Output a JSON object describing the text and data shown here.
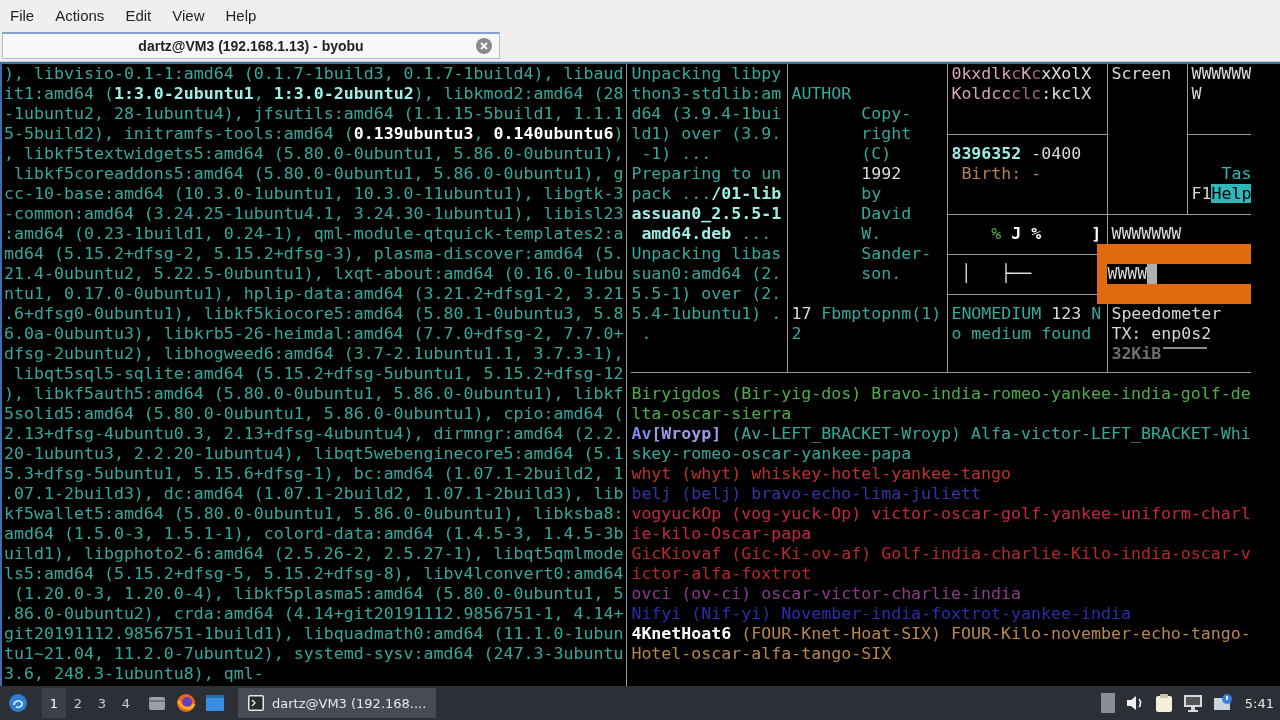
{
  "menu": [
    "File",
    "Actions",
    "Edit",
    "View",
    "Help"
  ],
  "tab": {
    "title": "dartz@VM3 (192.168.1.13) - byobu"
  },
  "terminal": {
    "main_pane": {
      "lines": [
        [
          {
            "text": "), libvisio-0.1-1:amd64 (0.1.7-1build3, 0.1.7-1build4), libaud"
          }
        ],
        [
          {
            "text": "it1:amd64 ("
          },
          {
            "text": "1:3.0-2ubuntu1",
            "bold": true,
            "color": "#9eeee6"
          },
          {
            "text": ", "
          },
          {
            "text": "1:3.0-2ubuntu2",
            "bold": true,
            "color": "#9eeee6"
          },
          {
            "text": "), libkmod2:amd64 (28"
          }
        ],
        [
          {
            "text": "-1ubuntu2, 28-1ubuntu4), jfsutils:amd64 (1.1.15-5build1, 1.1.1"
          }
        ],
        [
          {
            "text": "5-5build2), initramfs-tools:amd64 ("
          },
          {
            "text": "0.139ubuntu3",
            "bold": true,
            "color": "#ffffff"
          },
          {
            "text": ", "
          },
          {
            "text": "0.140ubuntu6",
            "bold": true,
            "color": "#ffffff"
          },
          {
            "text": ")"
          }
        ],
        [
          {
            "text": ", libkf5textwidgets5:amd64 (5.80.0-0ubuntu1, 5.86.0-0ubuntu1),"
          }
        ],
        [
          {
            "text": " libkf5coreaddons5:amd64 (5.80.0-0ubuntu1, 5.86.0-0ubuntu1), g"
          }
        ],
        [
          {
            "text": "cc-10-base:amd64 (10.3.0-1ubuntu1, 10.3.0-11ubuntu1), libgtk-3"
          }
        ],
        [
          {
            "text": "-common:amd64 (3.24.25-1ubuntu4.1, 3.24.30-1ubuntu1), libisl23"
          }
        ],
        [
          {
            "text": ":amd64 (0.23-1build1, 0.24-1), qml-module-qtquick-templates2:a"
          }
        ],
        [
          {
            "text": "md64 (5.15.2+dfsg-2, 5.15.2+dfsg-3), plasma-discover:amd64 (5."
          }
        ],
        [
          {
            "text": "21.4-0ubuntu2, 5.22.5-0ubuntu1), lxqt-about:amd64 (0.16.0-1ubu"
          }
        ],
        [
          {
            "text": "ntu1, 0.17.0-0ubuntu1), hplip-data:amd64 (3.21.2+dfsg1-2, 3.21"
          }
        ],
        [
          {
            "text": ".6+dfsg0-0ubuntu1), libkf5kiocore5:amd64 (5.80.1-0ubuntu3, 5.8"
          }
        ],
        [
          {
            "text": "6.0a-0ubuntu3), libkrb5-26-heimdal:amd64 (7.7.0+dfsg-2, 7.7.0+"
          }
        ],
        [
          {
            "text": "dfsg-2ubuntu2), libhogweed6:amd64 (3.7-2.1ubuntu1.1, 3.7.3-1),"
          }
        ],
        [
          {
            "text": " libqt5sql5-sqlite:amd64 (5.15.2+dfsg-5ubuntu1, 5.15.2+dfsg-12"
          }
        ],
        [
          {
            "text": "), libkf5auth5:amd64 (5.80.0-0ubuntu1, 5.86.0-0ubuntu1), libkf"
          }
        ],
        [
          {
            "text": "5solid5:amd64 (5.80.0-0ubuntu1, 5.86.0-0ubuntu1), cpio:amd64 ("
          }
        ],
        [
          {
            "text": "2.13+dfsg-4ubuntu0.3, 2.13+dfsg-4ubuntu4), dirmngr:amd64 (2.2."
          }
        ],
        [
          {
            "text": "20-1ubuntu3, 2.2.20-1ubuntu4), libqt5webenginecore5:amd64 (5.1"
          }
        ],
        [
          {
            "text": "5.3+dfsg-5ubuntu1, 5.15.6+dfsg-1), bc:amd64 (1.07.1-2build2, 1"
          }
        ],
        [
          {
            "text": ".07.1-2build3), dc:amd64 (1.07.1-2build2, 1.07.1-2build3), lib"
          }
        ],
        [
          {
            "text": "kf5wallet5:amd64 (5.80.0-0ubuntu1, 5.86.0-0ubuntu1), libksba8:"
          }
        ],
        [
          {
            "text": "amd64 (1.5.0-3, 1.5.1-1), colord-data:amd64 (1.4.5-3, 1.4.5-3b"
          }
        ],
        [
          {
            "text": "uild1), libgphoto2-6:amd64 (2.5.26-2, 2.5.27-1), libqt5qmlmode"
          }
        ],
        [
          {
            "text": "ls5:amd64 (5.15.2+dfsg-5, 5.15.2+dfsg-8), libv4lconvert0:amd64"
          }
        ],
        [
          {
            "text": " (1.20.0-3, 1.20.0-4), libkf5plasma5:amd64 (5.80.0-0ubuntu1, 5"
          }
        ],
        [
          {
            "text": ".86.0-0ubuntu2), crda:amd64 (4.14+git20191112.9856751-1, 4.14+"
          }
        ],
        [
          {
            "text": "git20191112.9856751-1build1), libquadmath0:amd64 (11.1.0-1ubun"
          }
        ],
        [
          {
            "text": "tu1~21.04, 11.2.0-7ubuntu2), systemd-sysv:amd64 (247.3-3ubuntu"
          }
        ],
        [
          {
            "text": "3.6, 248.3-1ubuntu8), qml-"
          }
        ]
      ]
    },
    "panes": [
      {
        "lines": [
          [
            {
              "text": "Unpacking libpy"
            }
          ],
          [
            {
              "text": "thon3-stdlib:am"
            }
          ],
          [
            {
              "text": "d64 (3.9.4-1bui"
            }
          ],
          [
            {
              "text": "ld1) over (3.9."
            }
          ],
          [
            {
              "text": " -1) ..."
            }
          ],
          [
            {
              "text": "Preparing to un"
            }
          ],
          [
            {
              "text": "pack ..."
            },
            {
              "text": "/01-lib",
              "bold": true,
              "color": "#9eeee6"
            }
          ],
          [
            {
              "text": "assuan0_2.5.5-1",
              "bold": true,
              "color": "#9eeee6"
            }
          ],
          [
            {
              "text": " amd64.deb",
              "bold": true,
              "color": "#9eeee6"
            },
            {
              "text": " ..."
            }
          ],
          [
            {
              "text": "Unpacking libas"
            }
          ],
          [
            {
              "text": "suan0:amd64 (2."
            }
          ],
          [
            {
              "text": "5.5-1) over (2."
            }
          ],
          [
            {
              "text": "5.4-1ubuntu1) ."
            }
          ],
          [
            {
              "text": " ."
            }
          ]
        ]
      },
      {
        "lines": [
          [
            {
              "text": "AUTHOR"
            }
          ],
          [
            {
              "text": "Copy-"
            }
          ],
          [
            {
              "text": "right"
            }
          ],
          [
            {
              "text": "(C)"
            }
          ],
          [
            {
              "text": "1992",
              "color": "#d8d8d8"
            }
          ],
          [
            {
              "text": "by"
            }
          ],
          [
            {
              "text": "David"
            }
          ],
          [
            {
              "text": "W."
            }
          ],
          [
            {
              "text": "Sander-"
            }
          ],
          [
            {
              "text": "son."
            }
          ],
          [
            {
              "text": "17",
              "color": "#d8d8d8"
            },
            {
              "text": " Fbmptopnm(1)"
            }
          ],
          [
            {
              "text": "2"
            }
          ]
        ]
      },
      {
        "lines": [
          [
            {
              "text": "0kxdlk",
              "color": "#d8a8b4"
            },
            {
              "text": "c",
              "color": "#a86878"
            },
            {
              "text": "K",
              "color": "#d8a8b4"
            },
            {
              "text": "c",
              "color": "#a86878"
            },
            {
              "text": "xXolX",
              "color": "#e8dcdc"
            }
          ],
          [
            {
              "text": "Koldcc",
              "color": "#d8a8b4"
            },
            {
              "text": "clc",
              "color": "#a86878"
            },
            {
              "text": ":kclX",
              "color": "#e8dcdc"
            }
          ]
        ]
      },
      {
        "lines": [
          [
            {
              "text": "8396352",
              "bold": true,
              "color": "#9eeee6"
            },
            {
              "text": " -0400",
              "color": "#d8d8d8"
            }
          ],
          [
            {
              "text": " Birth: -",
              "color": "#b8805a"
            }
          ]
        ]
      },
      {
        "lines": [
          [
            {
              "text": "    %",
              "color": "#5aa84a"
            },
            {
              "text": " J %",
              "bold": true,
              "color": "#ffffff"
            },
            {
              "text": "     ]",
              "bold": true,
              "color": "#ffffff"
            }
          ]
        ]
      },
      {
        "lines": [
          [
            {
              "text": " │   ├──",
              "color": "#e0e0e0"
            }
          ]
        ]
      },
      {
        "lines": [
          [
            {
              "text": "ENOMEDIUM"
            },
            {
              "text": " 123",
              "color": "#d8d8d8"
            },
            {
              "text": " N"
            }
          ],
          [
            {
              "text": "o medium found"
            }
          ]
        ]
      },
      {
        "lines": [
          [
            {
              "text": "Screen",
              "color": "#d8d8d8"
            }
          ]
        ]
      },
      {
        "lines": [
          [
            {
              "text": "WWWWWW",
              "color": "#d8d8d8"
            }
          ],
          [
            {
              "text": "W",
              "color": "#d8d8d8"
            }
          ]
        ]
      },
      {
        "lines": [
          [
            {
              "text": "Tas",
              "color": "#2fb8b8"
            }
          ],
          [
            {
              "text": "F1",
              "color": "#d8d8d8"
            },
            {
              "text": "Help",
              "highlight": true
            }
          ]
        ]
      },
      {
        "lines": [
          [
            {
              "text": "WWWWWWW",
              "color": "#d8d8d8"
            }
          ]
        ],
        "framed": {
          "text": "WWWW",
          "cursor": true
        },
        "lines_after": [
          [
            {
              "text": "Speedometer",
              "color": "#d8d8d8"
            }
          ],
          [
            {
              "text": "TX: enp0s2",
              "color": "#d8d8d8"
            }
          ],
          [
            {
              "text": "32KiB",
              "bold": true,
              "color": "#707070"
            }
          ]
        ]
      }
    ],
    "bottom_pane": {
      "lines": [
        [
          {
            "text": "Biryigdos (Bir-yig-dos) Bravo-india-romeo-yankee-india-golf-de",
            "color": "#4cae48"
          }
        ],
        [
          {
            "text": "lta-oscar-sierra",
            "color": "#4cae48"
          }
        ],
        [
          {
            "text": "Av",
            "bold": true,
            "color": "#7a88f0"
          },
          {
            "text": "[Wroyp]",
            "bold": true,
            "color": "#9a9ae8"
          },
          {
            "text": " (Av-LEFT_BRACKET-Wroyp) Alfa-victor-LEFT_BRACKET-Whi",
            "color": "#35a89b"
          }
        ],
        [
          {
            "text": "skey-romeo-oscar-yankee-papa",
            "color": "#35a89b"
          }
        ],
        [
          {
            "text": "whyt (whyt) whiskey-hotel-yankee-tango",
            "color": "#c0302c"
          }
        ],
        [
          {
            "text": "belj (belj) bravo-echo-lima-juliett",
            "color": "#3434a4"
          }
        ],
        [
          {
            "text": "vogyuckOp (vog-yuck-Op) victor-oscar-golf-yankee-uniform-charl",
            "color": "#c42644"
          }
        ],
        [
          {
            "text": "ie-kilo-Oscar-papa",
            "color": "#c42644"
          }
        ],
        [
          {
            "text": "GicKiovaf (Gic-Ki-ov-af) Golf-india-charlie-Kilo-india-oscar-v",
            "color": "#b8282a"
          }
        ],
        [
          {
            "text": "ictor-alfa-foxtrot",
            "color": "#b8282a"
          }
        ],
        [
          {
            "text": "ovci (ov-ci) oscar-victor-charlie-india",
            "color": "#8c3a8c"
          }
        ],
        [
          {
            "text": "Nifyi (Nif-yi) November-india-foxtrot-yankee-india",
            "color": "#2c2cac"
          }
        ],
        [
          {
            "text": "4KnetHoat6",
            "bold": true,
            "color": "#ffffff"
          },
          {
            "text": " (FOUR-Knet-Hoat-SIX) FOUR-Kilo-november-echo-tango-",
            "color": "#b8884e"
          }
        ],
        [
          {
            "text": "Hotel-oscar-alfa-tango-SIX",
            "color": "#b8884e"
          }
        ]
      ]
    }
  },
  "taskbar": {
    "workspaces": [
      {
        "label": "1",
        "selected": true
      },
      {
        "label": "2",
        "selected": false
      },
      {
        "label": "3",
        "selected": false
      },
      {
        "label": "4",
        "selected": false
      }
    ],
    "task": {
      "title": "dartz@VM3 (192.168....",
      "selected": true
    },
    "clock": "5:41"
  }
}
